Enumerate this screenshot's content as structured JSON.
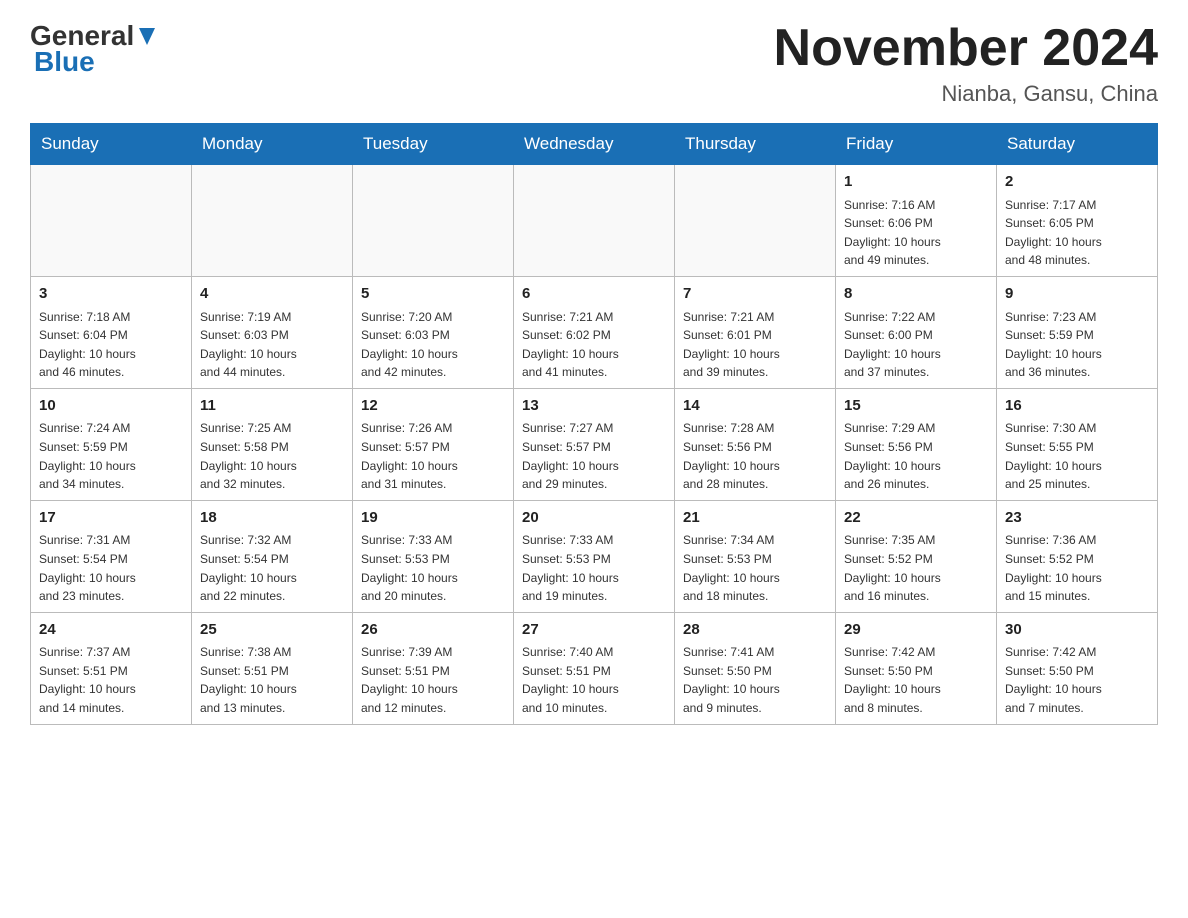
{
  "header": {
    "logo_general": "General",
    "logo_blue": "Blue",
    "month_title": "November 2024",
    "location": "Nianba, Gansu, China"
  },
  "weekdays": [
    "Sunday",
    "Monday",
    "Tuesday",
    "Wednesday",
    "Thursday",
    "Friday",
    "Saturday"
  ],
  "weeks": [
    [
      {
        "day": "",
        "info": ""
      },
      {
        "day": "",
        "info": ""
      },
      {
        "day": "",
        "info": ""
      },
      {
        "day": "",
        "info": ""
      },
      {
        "day": "",
        "info": ""
      },
      {
        "day": "1",
        "info": "Sunrise: 7:16 AM\nSunset: 6:06 PM\nDaylight: 10 hours\nand 49 minutes."
      },
      {
        "day": "2",
        "info": "Sunrise: 7:17 AM\nSunset: 6:05 PM\nDaylight: 10 hours\nand 48 minutes."
      }
    ],
    [
      {
        "day": "3",
        "info": "Sunrise: 7:18 AM\nSunset: 6:04 PM\nDaylight: 10 hours\nand 46 minutes."
      },
      {
        "day": "4",
        "info": "Sunrise: 7:19 AM\nSunset: 6:03 PM\nDaylight: 10 hours\nand 44 minutes."
      },
      {
        "day": "5",
        "info": "Sunrise: 7:20 AM\nSunset: 6:03 PM\nDaylight: 10 hours\nand 42 minutes."
      },
      {
        "day": "6",
        "info": "Sunrise: 7:21 AM\nSunset: 6:02 PM\nDaylight: 10 hours\nand 41 minutes."
      },
      {
        "day": "7",
        "info": "Sunrise: 7:21 AM\nSunset: 6:01 PM\nDaylight: 10 hours\nand 39 minutes."
      },
      {
        "day": "8",
        "info": "Sunrise: 7:22 AM\nSunset: 6:00 PM\nDaylight: 10 hours\nand 37 minutes."
      },
      {
        "day": "9",
        "info": "Sunrise: 7:23 AM\nSunset: 5:59 PM\nDaylight: 10 hours\nand 36 minutes."
      }
    ],
    [
      {
        "day": "10",
        "info": "Sunrise: 7:24 AM\nSunset: 5:59 PM\nDaylight: 10 hours\nand 34 minutes."
      },
      {
        "day": "11",
        "info": "Sunrise: 7:25 AM\nSunset: 5:58 PM\nDaylight: 10 hours\nand 32 minutes."
      },
      {
        "day": "12",
        "info": "Sunrise: 7:26 AM\nSunset: 5:57 PM\nDaylight: 10 hours\nand 31 minutes."
      },
      {
        "day": "13",
        "info": "Sunrise: 7:27 AM\nSunset: 5:57 PM\nDaylight: 10 hours\nand 29 minutes."
      },
      {
        "day": "14",
        "info": "Sunrise: 7:28 AM\nSunset: 5:56 PM\nDaylight: 10 hours\nand 28 minutes."
      },
      {
        "day": "15",
        "info": "Sunrise: 7:29 AM\nSunset: 5:56 PM\nDaylight: 10 hours\nand 26 minutes."
      },
      {
        "day": "16",
        "info": "Sunrise: 7:30 AM\nSunset: 5:55 PM\nDaylight: 10 hours\nand 25 minutes."
      }
    ],
    [
      {
        "day": "17",
        "info": "Sunrise: 7:31 AM\nSunset: 5:54 PM\nDaylight: 10 hours\nand 23 minutes."
      },
      {
        "day": "18",
        "info": "Sunrise: 7:32 AM\nSunset: 5:54 PM\nDaylight: 10 hours\nand 22 minutes."
      },
      {
        "day": "19",
        "info": "Sunrise: 7:33 AM\nSunset: 5:53 PM\nDaylight: 10 hours\nand 20 minutes."
      },
      {
        "day": "20",
        "info": "Sunrise: 7:33 AM\nSunset: 5:53 PM\nDaylight: 10 hours\nand 19 minutes."
      },
      {
        "day": "21",
        "info": "Sunrise: 7:34 AM\nSunset: 5:53 PM\nDaylight: 10 hours\nand 18 minutes."
      },
      {
        "day": "22",
        "info": "Sunrise: 7:35 AM\nSunset: 5:52 PM\nDaylight: 10 hours\nand 16 minutes."
      },
      {
        "day": "23",
        "info": "Sunrise: 7:36 AM\nSunset: 5:52 PM\nDaylight: 10 hours\nand 15 minutes."
      }
    ],
    [
      {
        "day": "24",
        "info": "Sunrise: 7:37 AM\nSunset: 5:51 PM\nDaylight: 10 hours\nand 14 minutes."
      },
      {
        "day": "25",
        "info": "Sunrise: 7:38 AM\nSunset: 5:51 PM\nDaylight: 10 hours\nand 13 minutes."
      },
      {
        "day": "26",
        "info": "Sunrise: 7:39 AM\nSunset: 5:51 PM\nDaylight: 10 hours\nand 12 minutes."
      },
      {
        "day": "27",
        "info": "Sunrise: 7:40 AM\nSunset: 5:51 PM\nDaylight: 10 hours\nand 10 minutes."
      },
      {
        "day": "28",
        "info": "Sunrise: 7:41 AM\nSunset: 5:50 PM\nDaylight: 10 hours\nand 9 minutes."
      },
      {
        "day": "29",
        "info": "Sunrise: 7:42 AM\nSunset: 5:50 PM\nDaylight: 10 hours\nand 8 minutes."
      },
      {
        "day": "30",
        "info": "Sunrise: 7:42 AM\nSunset: 5:50 PM\nDaylight: 10 hours\nand 7 minutes."
      }
    ]
  ]
}
